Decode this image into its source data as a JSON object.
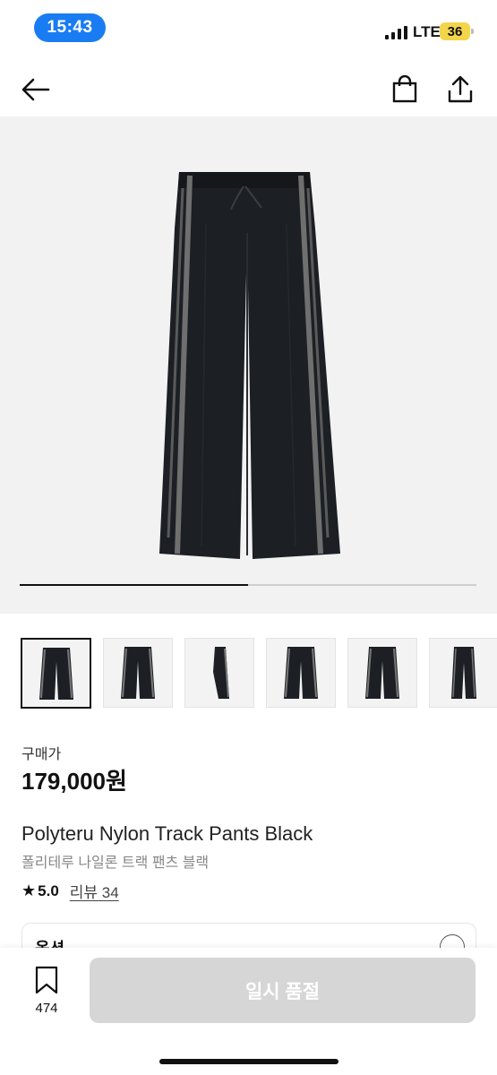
{
  "status_bar": {
    "time": "15:43",
    "network": "LTE",
    "battery": "36"
  },
  "nav": {
    "back_icon": "back-arrow-icon",
    "bag_icon": "shopping-bag-icon",
    "share_icon": "share-icon"
  },
  "gallery": {
    "image_count": 6,
    "selected_index": 0,
    "scroll_progress": 0.5
  },
  "product": {
    "price_label": "구매가",
    "price": "179,000원",
    "title": "Polyteru Nylon Track Pants Black",
    "subtitle": "폴리테루 나일론 트랙 팬츠 블랙",
    "rating": "5.0",
    "review_label": "리뷰 34"
  },
  "option": {
    "label": "옵션"
  },
  "bottom_bar": {
    "like_count": "474",
    "buy_label": "일시 품절"
  },
  "colors": {
    "accent": "#1a7cf2",
    "disabled_button": "#d6d6d6",
    "product": "#1c1f24",
    "stripe": "#6f6f6f"
  }
}
